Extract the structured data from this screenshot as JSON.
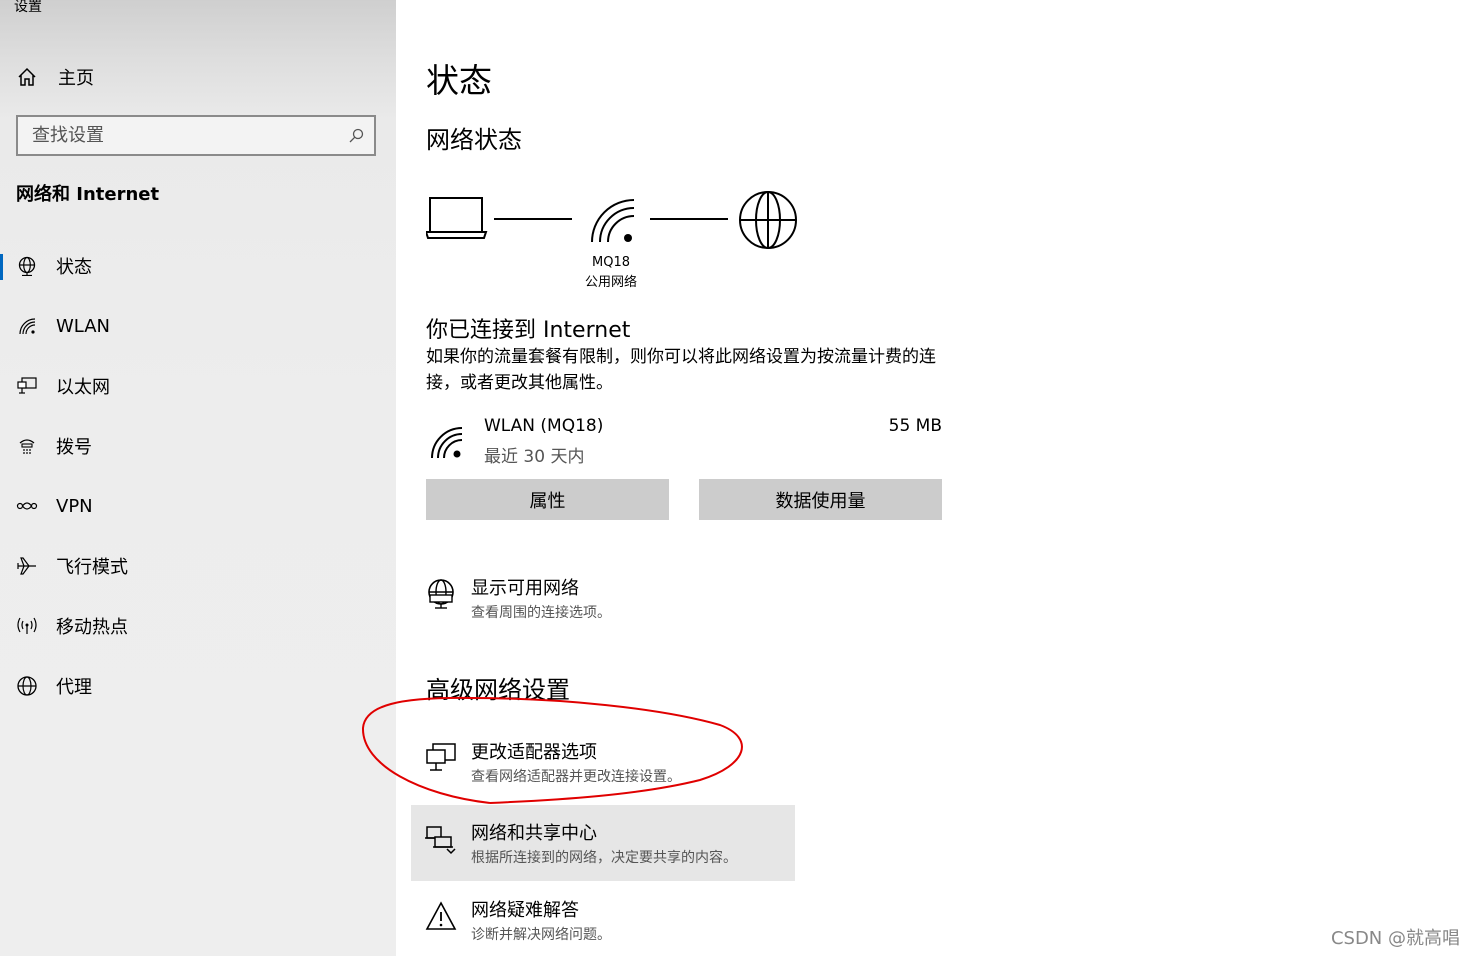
{
  "window": {
    "title": "设置"
  },
  "sidebar": {
    "home_label": "主页",
    "search_placeholder": "查找设置",
    "section_title": "网络和 Internet",
    "items": [
      {
        "label": "状态",
        "icon": "globe-status-icon",
        "active": true
      },
      {
        "label": "WLAN",
        "icon": "wifi-icon"
      },
      {
        "label": "以太网",
        "icon": "ethernet-icon"
      },
      {
        "label": "拨号",
        "icon": "dialup-icon"
      },
      {
        "label": "VPN",
        "icon": "vpn-icon"
      },
      {
        "label": "飞行模式",
        "icon": "airplane-icon"
      },
      {
        "label": "移动热点",
        "icon": "hotspot-icon"
      },
      {
        "label": "代理",
        "icon": "proxy-globe-icon"
      }
    ]
  },
  "main": {
    "title": "状态",
    "network_status_heading": "网络状态",
    "network": {
      "name": "MQ18",
      "type": "公用网络"
    },
    "connected_title": "你已连接到 Internet",
    "connected_desc": "如果你的流量套餐有限制，则你可以将此网络设置为按流量计费的连接，或者更改其他属性。",
    "wlan": {
      "name": "WLAN (MQ18)",
      "period": "最近 30 天内",
      "usage": "55 MB"
    },
    "buttons": {
      "properties": "属性",
      "data_usage": "数据使用量"
    },
    "show_networks": {
      "title": "显示可用网络",
      "subtitle": "查看周围的连接选项。"
    },
    "advanced_heading": "高级网络设置",
    "advanced_items": [
      {
        "title": "更改适配器选项",
        "subtitle": "查看网络适配器并更改连接设置。"
      },
      {
        "title": "网络和共享中心",
        "subtitle": "根据所连接到的网络，决定要共享的内容。"
      },
      {
        "title": "网络疑难解答",
        "subtitle": "诊断并解决网络问题。"
      }
    ]
  },
  "watermark": "CSDN @就高唱",
  "colors": {
    "accent": "#0067c0",
    "annotation": "#e00000",
    "button": "#cccccc",
    "hover": "#e6e6e6"
  }
}
